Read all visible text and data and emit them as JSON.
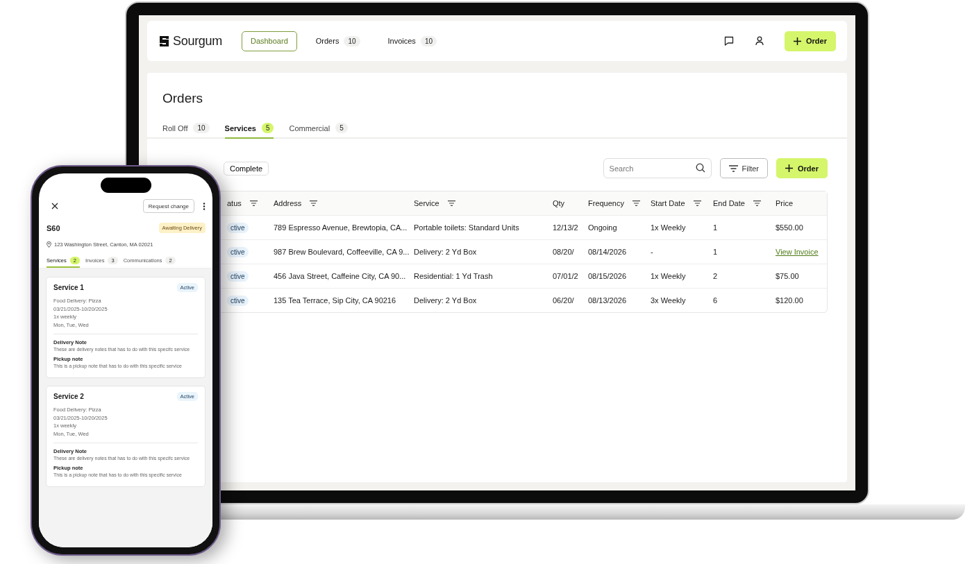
{
  "nav": {
    "logo": "Sourgum",
    "items": [
      {
        "label": "Dashboard",
        "selected": true
      },
      {
        "label": "Orders",
        "count": "10",
        "selected": false
      },
      {
        "label": "Invoices",
        "count": "10",
        "selected": false
      }
    ],
    "action": "Order"
  },
  "page": {
    "title": "Orders",
    "tabs": [
      {
        "label": "Roll Off",
        "count": "10",
        "selected": false
      },
      {
        "label": "Services",
        "count": "5",
        "selected": true
      },
      {
        "label": "Commercial",
        "count": "5",
        "selected": false
      }
    ],
    "filter_chip": "Complete",
    "search": {
      "placeholder": "Search"
    },
    "filter_button": "Filter",
    "add_button": "Order"
  },
  "table": {
    "columns": [
      {
        "label": "atus",
        "filter": true
      },
      {
        "label": "Address",
        "filter": true
      },
      {
        "label": "Service",
        "filter": true
      },
      {
        "label": "Qty",
        "filter": false
      },
      {
        "label": "Frequency",
        "filter": true
      },
      {
        "label": "Start Date",
        "filter": true
      },
      {
        "label": "End Date",
        "filter": true
      },
      {
        "label": "Price",
        "filter": false
      }
    ],
    "rows": [
      {
        "cells": [
          {
            "kind": "badge",
            "text": "ctive"
          },
          {
            "kind": "text",
            "text": "789 Espresso Avenue, Brewtopia, CA..."
          },
          {
            "kind": "text",
            "text": "Portable toilets: Standard Units"
          },
          {
            "kind": "text",
            "text": "12/13/2"
          },
          {
            "kind": "text",
            "text": "Ongoing"
          },
          {
            "kind": "text",
            "text": "1x Weekly"
          },
          {
            "kind": "text",
            "text": "1"
          },
          {
            "kind": "text",
            "text": "$550.00"
          }
        ]
      },
      {
        "cells": [
          {
            "kind": "badge",
            "text": "ctive"
          },
          {
            "kind": "text",
            "text": "987 Brew Boulevard, Coffeeville, CA 9..."
          },
          {
            "kind": "text",
            "text": "Delivery: 2 Yd Box"
          },
          {
            "kind": "text",
            "text": "08/20/"
          },
          {
            "kind": "text",
            "text": "08/14/2026"
          },
          {
            "kind": "text",
            "text": "-"
          },
          {
            "kind": "text",
            "text": "1"
          },
          {
            "kind": "link",
            "text": "View Invoice"
          }
        ]
      },
      {
        "cells": [
          {
            "kind": "badge",
            "text": "ctive"
          },
          {
            "kind": "text",
            "text": "456 Java Street, Caffeine City, CA 90..."
          },
          {
            "kind": "text",
            "text": "Residential: 1 Yd Trash"
          },
          {
            "kind": "text",
            "text": "07/01/2"
          },
          {
            "kind": "text",
            "text": "08/15/2026"
          },
          {
            "kind": "text",
            "text": "1x Weekly"
          },
          {
            "kind": "text",
            "text": "2"
          },
          {
            "kind": "text",
            "text": "$75.00"
          }
        ]
      },
      {
        "cells": [
          {
            "kind": "badge",
            "text": "ctive"
          },
          {
            "kind": "text",
            "text": "135 Tea Terrace, Sip City, CA 90216"
          },
          {
            "kind": "text",
            "text": "Delivery: 2 Yd Box"
          },
          {
            "kind": "text",
            "text": "06/20/"
          },
          {
            "kind": "text",
            "text": "08/13/2026"
          },
          {
            "kind": "text",
            "text": "3x Weekly"
          },
          {
            "kind": "text",
            "text": "6"
          },
          {
            "kind": "text",
            "text": "$120.00"
          }
        ]
      }
    ]
  },
  "phone": {
    "request_button": "Request change",
    "order_id": "S60",
    "status": "Awaiting Delivery",
    "address": "123 Washington Street, Canton, MA 02021",
    "tabs": [
      {
        "label": "Services",
        "count": "2",
        "selected": true
      },
      {
        "label": "Invoices",
        "count": "3",
        "selected": false
      },
      {
        "label": "Communications",
        "count": "2",
        "selected": false
      }
    ],
    "services": [
      {
        "title": "Service 1",
        "status": "Active",
        "details": [
          "Food Delivery: Pizza",
          "03/21/2025-10/20/2025",
          "1x weekly",
          "Mon, Tue, Wed"
        ],
        "notes": [
          {
            "title": "Delivery Note",
            "text": "These are delivery notes that has to do with this specifc service"
          },
          {
            "title": "Pickup note",
            "text": "This is a pickup note that has to do with this specific service"
          }
        ]
      },
      {
        "title": "Service 2",
        "status": "Active",
        "details": [
          "Food Delivery: Pizza",
          "03/21/2025-10/20/2025",
          "1x weekly",
          "Mon, Tue, Wed"
        ],
        "notes": [
          {
            "title": "Delivery Note",
            "text": "These are delivery notes that has to do with this specifc service"
          },
          {
            "title": "Pickup note",
            "text": "This is a pickup note that has to do with this specific service"
          }
        ]
      }
    ]
  }
}
